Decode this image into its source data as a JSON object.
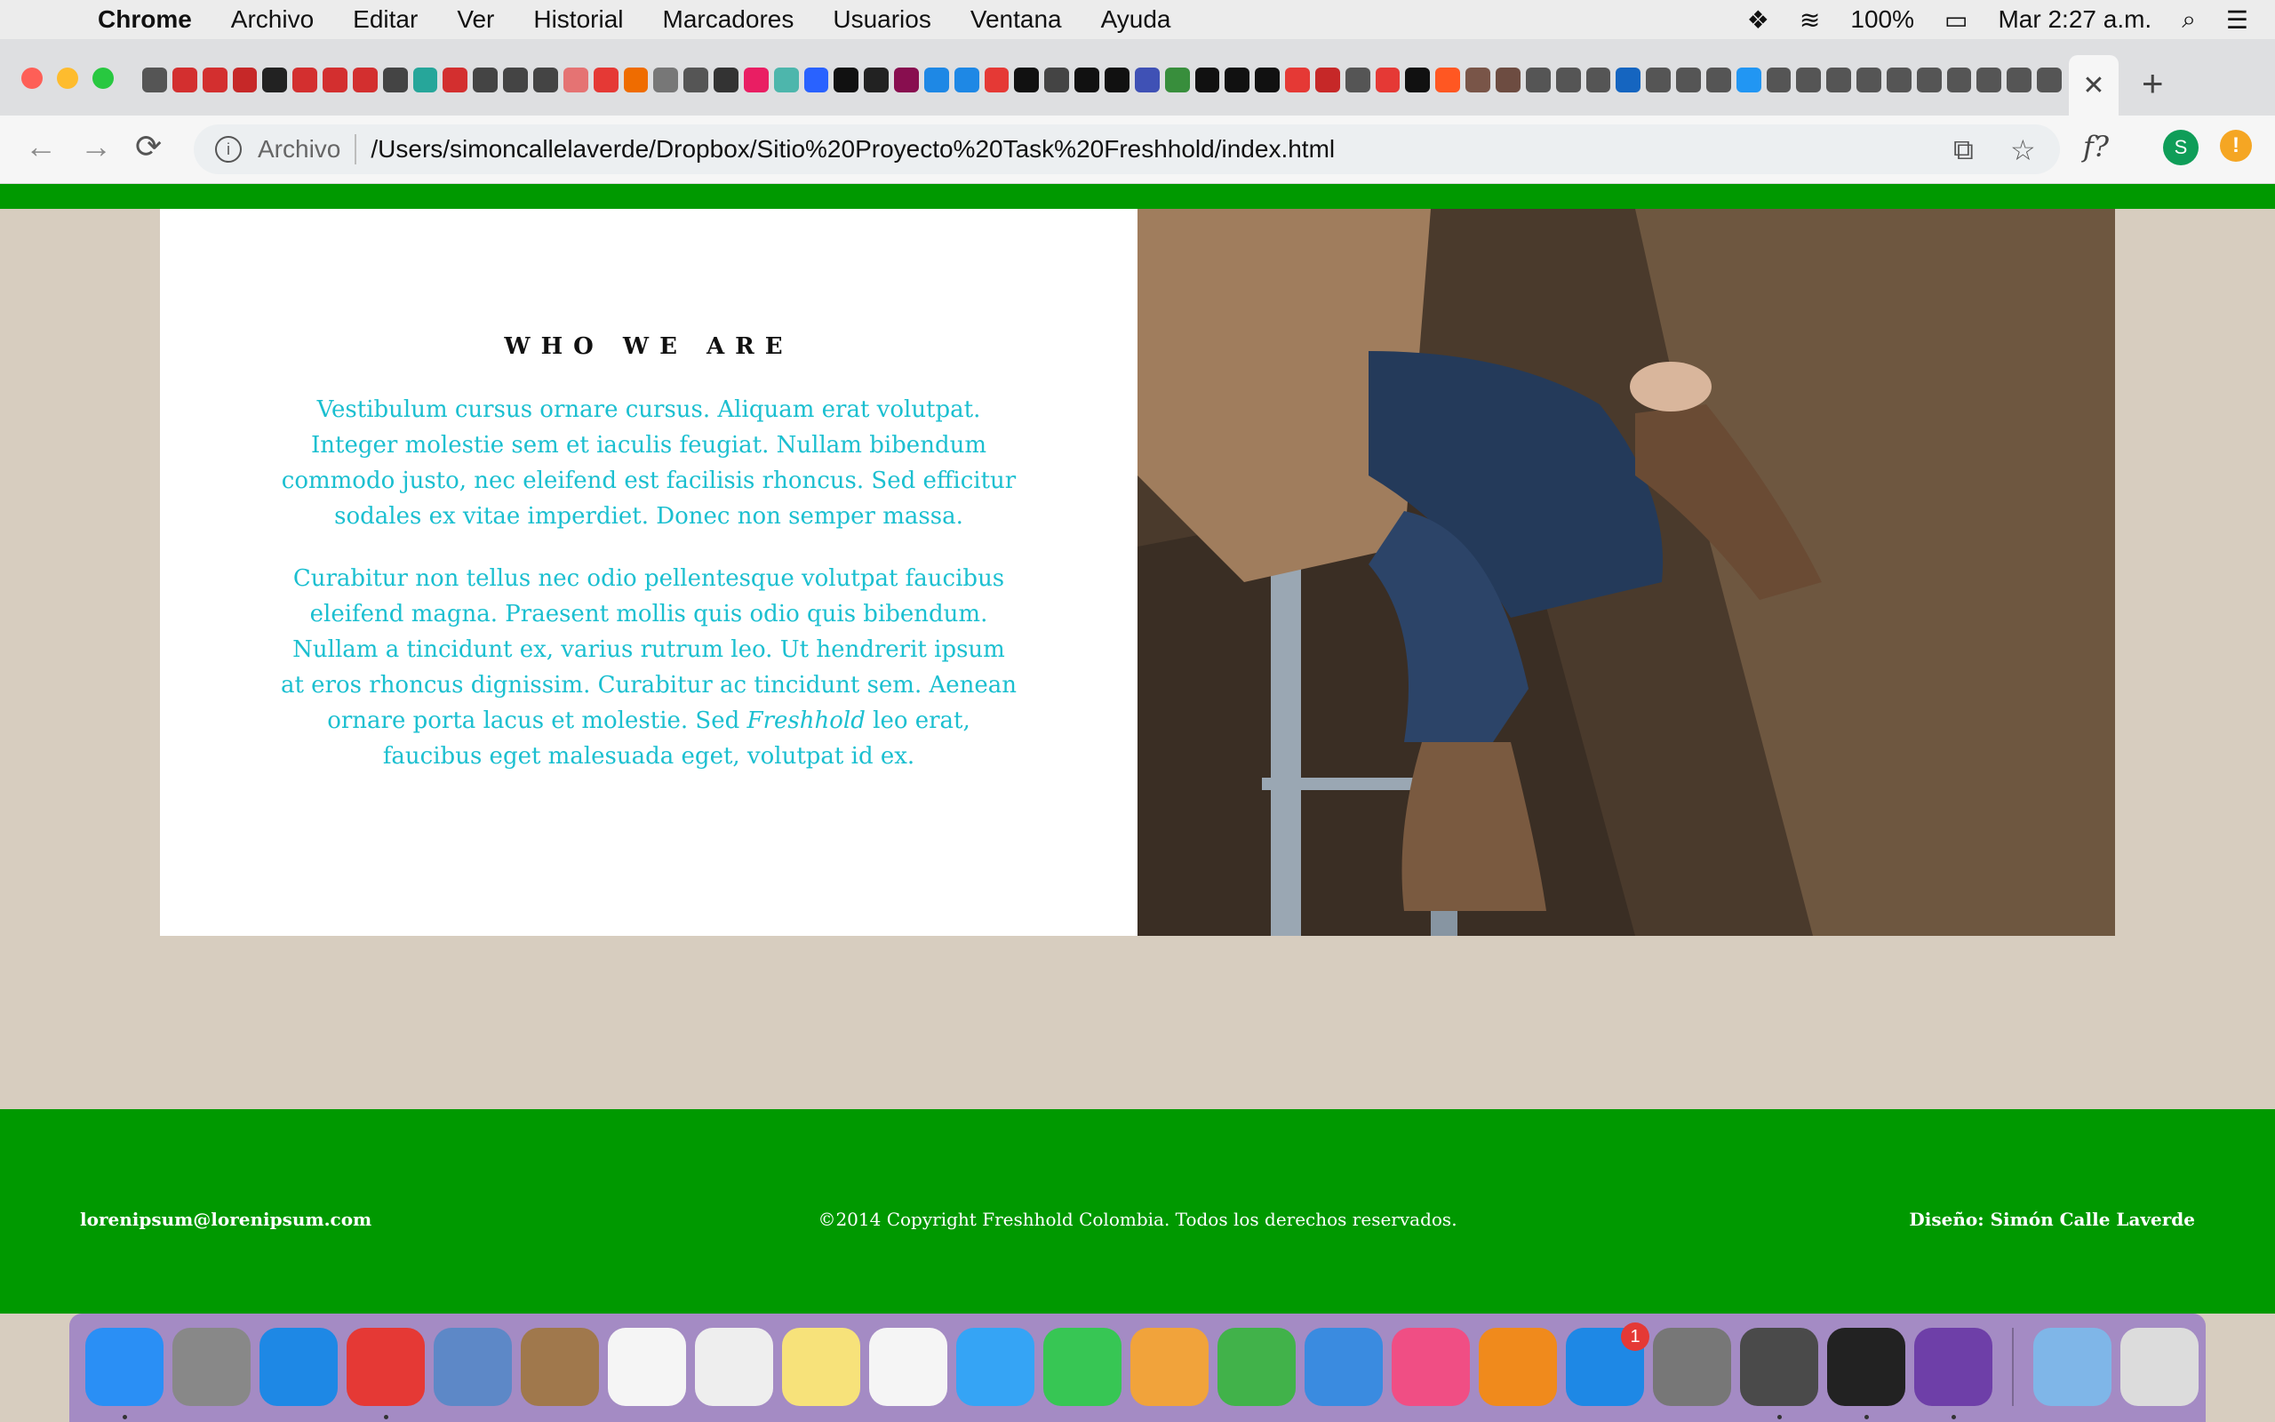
{
  "menubar": {
    "apple": "",
    "app_name": "Chrome",
    "items": [
      "Archivo",
      "Editar",
      "Ver",
      "Historial",
      "Marcadores",
      "Usuarios",
      "Ventana",
      "Ayuda"
    ],
    "battery": "100%",
    "clock": "Mar 2:27 a.m."
  },
  "tabs": {
    "active_close": "✕",
    "new_tab": "+",
    "favicon_colors": [
      "#555",
      "#d32f2f",
      "#d32f2f",
      "#c62828",
      "#222",
      "#d32f2f",
      "#d32f2f",
      "#d32f2f",
      "#444",
      "#26a69a",
      "#d32f2f",
      "#444",
      "#444",
      "#444",
      "#e57373",
      "#e53935",
      "#ef6c00",
      "#777",
      "#555",
      "#333",
      "#e91e63",
      "#4db6ac",
      "#2962ff",
      "#111",
      "#222",
      "#880e4f",
      "#1e88e5",
      "#1e88e5",
      "#e53935",
      "#111",
      "#444",
      "#111",
      "#111",
      "#3f51b5",
      "#388e3c",
      "#111",
      "#111",
      "#111",
      "#e53935",
      "#c62828",
      "#555",
      "#e53935",
      "#111",
      "#ff5722",
      "#795548",
      "#6d4c41",
      "#555",
      "#555",
      "#555",
      "#1565c0",
      "#555",
      "#555",
      "#555",
      "#2196f3",
      "#555",
      "#555",
      "#555",
      "#555",
      "#555",
      "#555",
      "#555",
      "#555",
      "#555",
      "#555"
    ]
  },
  "toolbar": {
    "back": "←",
    "forward": "→",
    "reload": "⟳",
    "info": "i",
    "secure_label": "Archivo",
    "url": "/Users/simoncallelaverde/Dropbox/Sitio%20Proyecto%20Task%20Freshhold/index.html",
    "translate": "⧉",
    "star": "☆",
    "ext_f": "f?",
    "avatar": "S",
    "alert": "!"
  },
  "about": {
    "heading": "WHO WE ARE",
    "p1": "Vestibulum cursus ornare cursus. Aliquam erat volutpat. Integer molestie sem et iaculis feugiat. Nullam bibendum commodo justo, nec eleifend est facilisis rhoncus. Sed efficitur sodales ex vitae imperdiet. Donec non semper massa.",
    "p2_before": "Curabitur non tellus nec odio pellentesque volutpat faucibus eleifend magna. Praesent mollis quis odio quis bibendum. Nullam a tincidunt ex, varius rutrum leo. Ut hendrerit ipsum at eros rhoncus dignissim. Curabitur ac tincidunt sem. Aenean ornare porta lacus et molestie. Sed ",
    "p2_em": "Freshhold",
    "p2_after": " leo erat, faucibus eget malesuada eget, volutpat id ex."
  },
  "footer": {
    "email": "lorenipsum@lorenipsum.com",
    "copyright": "©2014 Copyright Freshhold Colombia. Todos los derechos reservados.",
    "credit": "Diseño: Simón Calle Laverde"
  },
  "dock": {
    "badge": "1",
    "apps": [
      {
        "name": "finder",
        "color": "#2a8ff5",
        "dot": true
      },
      {
        "name": "launchpad",
        "color": "#888",
        "dot": false
      },
      {
        "name": "safari",
        "color": "#1e88e5",
        "dot": false
      },
      {
        "name": "chrome",
        "color": "#e53935",
        "dot": true
      },
      {
        "name": "mail",
        "color": "#5d88c7",
        "dot": false
      },
      {
        "name": "contacts",
        "color": "#a0784c",
        "dot": false
      },
      {
        "name": "reminders",
        "color": "#f5f5f5",
        "dot": false
      },
      {
        "name": "calendar",
        "color": "#eeeeee",
        "dot": false
      },
      {
        "name": "notes",
        "color": "#f7e27a",
        "dot": false
      },
      {
        "name": "photos",
        "color": "#f5f5f5",
        "dot": false
      },
      {
        "name": "messages",
        "color": "#35a4f5",
        "dot": false
      },
      {
        "name": "facetime",
        "color": "#37c654",
        "dot": false
      },
      {
        "name": "pages",
        "color": "#f1a33b",
        "dot": false
      },
      {
        "name": "numbers",
        "color": "#41b24a",
        "dot": false
      },
      {
        "name": "keynote",
        "color": "#3a8be0",
        "dot": false
      },
      {
        "name": "itunes",
        "color": "#f04e84",
        "dot": false
      },
      {
        "name": "ibooks",
        "color": "#f08a1c",
        "dot": false
      },
      {
        "name": "app-store",
        "color": "#1e88e5",
        "dot": false,
        "badge": true
      },
      {
        "name": "system-preferences",
        "color": "#777",
        "dot": false
      },
      {
        "name": "sublime-text",
        "color": "#4a4a4a",
        "dot": true
      },
      {
        "name": "terminal",
        "color": "#222",
        "dot": true
      },
      {
        "name": "github-desktop",
        "color": "#6e3fa8",
        "dot": true
      }
    ],
    "trail": [
      {
        "name": "downloads-folder",
        "color": "#7fb6e8"
      },
      {
        "name": "trash",
        "color": "#dcdcdc"
      }
    ]
  }
}
